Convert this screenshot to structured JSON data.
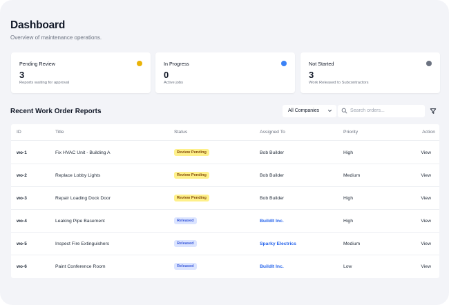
{
  "header": {
    "title": "Dashboard",
    "subtitle": "Overview of maintenance operations."
  },
  "cards": [
    {
      "label": "Pending Review",
      "count": "3",
      "description": "Reports waiting for approval",
      "dot_color": "#eab308"
    },
    {
      "label": "In Progress",
      "count": "0",
      "description": "Active jobs",
      "dot_color": "#3b82f6"
    },
    {
      "label": "Not Started",
      "count": "3",
      "description": "Work Released to Subcontractors",
      "dot_color": "#6b7280"
    }
  ],
  "section": {
    "title": "Recent Work Order Reports",
    "company_filter": "All Companies",
    "search_placeholder": "Search orders..."
  },
  "table": {
    "columns": [
      "ID",
      "Title",
      "Status",
      "Assigned To",
      "Priority",
      "Action"
    ],
    "rows": [
      {
        "id": "wo-1",
        "title": "Fix HVAC Unit - Building A",
        "status": "Review Pending",
        "status_type": "pending",
        "assigned": "Bob Builder",
        "assigned_link": false,
        "priority": "High",
        "action": "View"
      },
      {
        "id": "wo-2",
        "title": "Replace Lobby Lights",
        "status": "Review Pending",
        "status_type": "pending",
        "assigned": "Bob Builder",
        "assigned_link": false,
        "priority": "Medium",
        "action": "View"
      },
      {
        "id": "wo-3",
        "title": "Repair Loading Dock Door",
        "status": "Review Pending",
        "status_type": "pending",
        "assigned": "Bob Builder",
        "assigned_link": false,
        "priority": "High",
        "action": "View"
      },
      {
        "id": "wo-4",
        "title": "Leaking Pipe Basement",
        "status": "Released",
        "status_type": "released",
        "assigned": "BuildIt Inc.",
        "assigned_link": true,
        "priority": "High",
        "action": "View"
      },
      {
        "id": "wo-5",
        "title": "Inspect Fire Extinguishers",
        "status": "Released",
        "status_type": "released",
        "assigned": "Sparky Electrics",
        "assigned_link": true,
        "priority": "Medium",
        "action": "View"
      },
      {
        "id": "wo-6",
        "title": "Paint Conference Room",
        "status": "Released",
        "status_type": "released",
        "assigned": "BuildIt Inc.",
        "assigned_link": true,
        "priority": "Low",
        "action": "View"
      }
    ]
  }
}
